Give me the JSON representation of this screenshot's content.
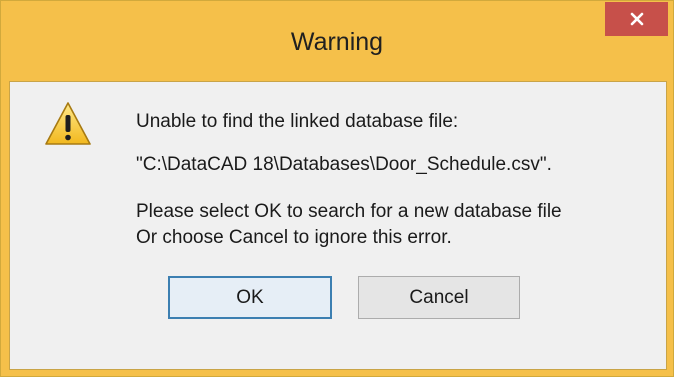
{
  "window": {
    "title": "Warning",
    "close_icon": "close-icon"
  },
  "message": {
    "icon": "warning-icon",
    "line1": "Unable to find the linked database file:",
    "path": "\"C:\\DataCAD 18\\Databases\\Door_Schedule.csv\".",
    "line3": "Please select OK to search for a new database file",
    "line4": "Or choose Cancel to ignore this error."
  },
  "buttons": {
    "ok": "OK",
    "cancel": "Cancel"
  },
  "colors": {
    "title_bar": "#f5c04a",
    "close_button": "#c7504a",
    "dialog_body": "#f0f0f0",
    "default_button_border": "#3c7fb1"
  }
}
